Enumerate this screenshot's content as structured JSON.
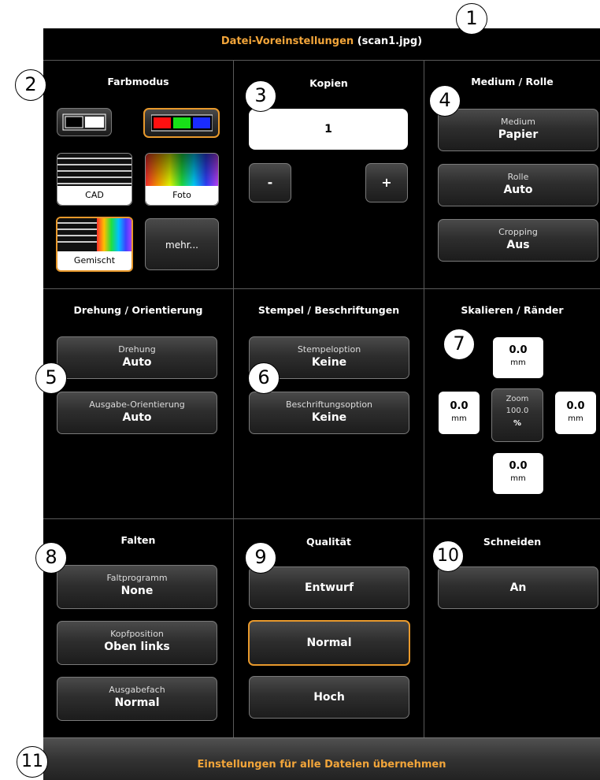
{
  "title": {
    "name": "Datei-Voreinstellungen",
    "file": "(scan1.jpg)"
  },
  "callouts": [
    "1",
    "2",
    "3",
    "4",
    "5",
    "6",
    "7",
    "8",
    "9",
    "10",
    "11"
  ],
  "farbmodus": {
    "title": "Farbmodus",
    "options": {
      "cad": "CAD",
      "foto": "Foto",
      "gemischt": "Gemischt",
      "mehr": "mehr..."
    }
  },
  "kopien": {
    "title": "Kopien",
    "value": "1",
    "minus": "-",
    "plus": "+"
  },
  "medium": {
    "title": "Medium / Rolle",
    "medium_label": "Medium",
    "medium_value": "Papier",
    "rolle_label": "Rolle",
    "rolle_value": "Auto",
    "cropping_label": "Cropping",
    "cropping_value": "Aus"
  },
  "drehung": {
    "title": "Drehung / Orientierung",
    "drehung_label": "Drehung",
    "drehung_value": "Auto",
    "ausgabe_label": "Ausgabe-Orientierung",
    "ausgabe_value": "Auto"
  },
  "stempel": {
    "title": "Stempel / Beschriftungen",
    "stempel_label": "Stempeloption",
    "stempel_value": "Keine",
    "beschriftung_label": "Beschriftungsoption",
    "beschriftung_value": "Keine"
  },
  "skalieren": {
    "title": "Skalieren / Ränder",
    "top": "0.0",
    "left": "0.0",
    "right": "0.0",
    "bottom": "0.0",
    "unit": "mm",
    "zoom_label": "Zoom",
    "zoom_value": "100.0",
    "zoom_unit": "%"
  },
  "falten": {
    "title": "Falten",
    "prog_label": "Faltprogramm",
    "prog_value": "None",
    "kopf_label": "Kopfposition",
    "kopf_value": "Oben links",
    "fach_label": "Ausgabefach",
    "fach_value": "Normal"
  },
  "qualitaet": {
    "title": "Qualität",
    "entwurf": "Entwurf",
    "normal": "Normal",
    "hoch": "Hoch"
  },
  "schneiden": {
    "title": "Schneiden",
    "value": "An"
  },
  "apply_all": "Einstellungen für alle Dateien übernehmen",
  "colors": {
    "accent": "#e8992c",
    "panel": "#000000"
  }
}
